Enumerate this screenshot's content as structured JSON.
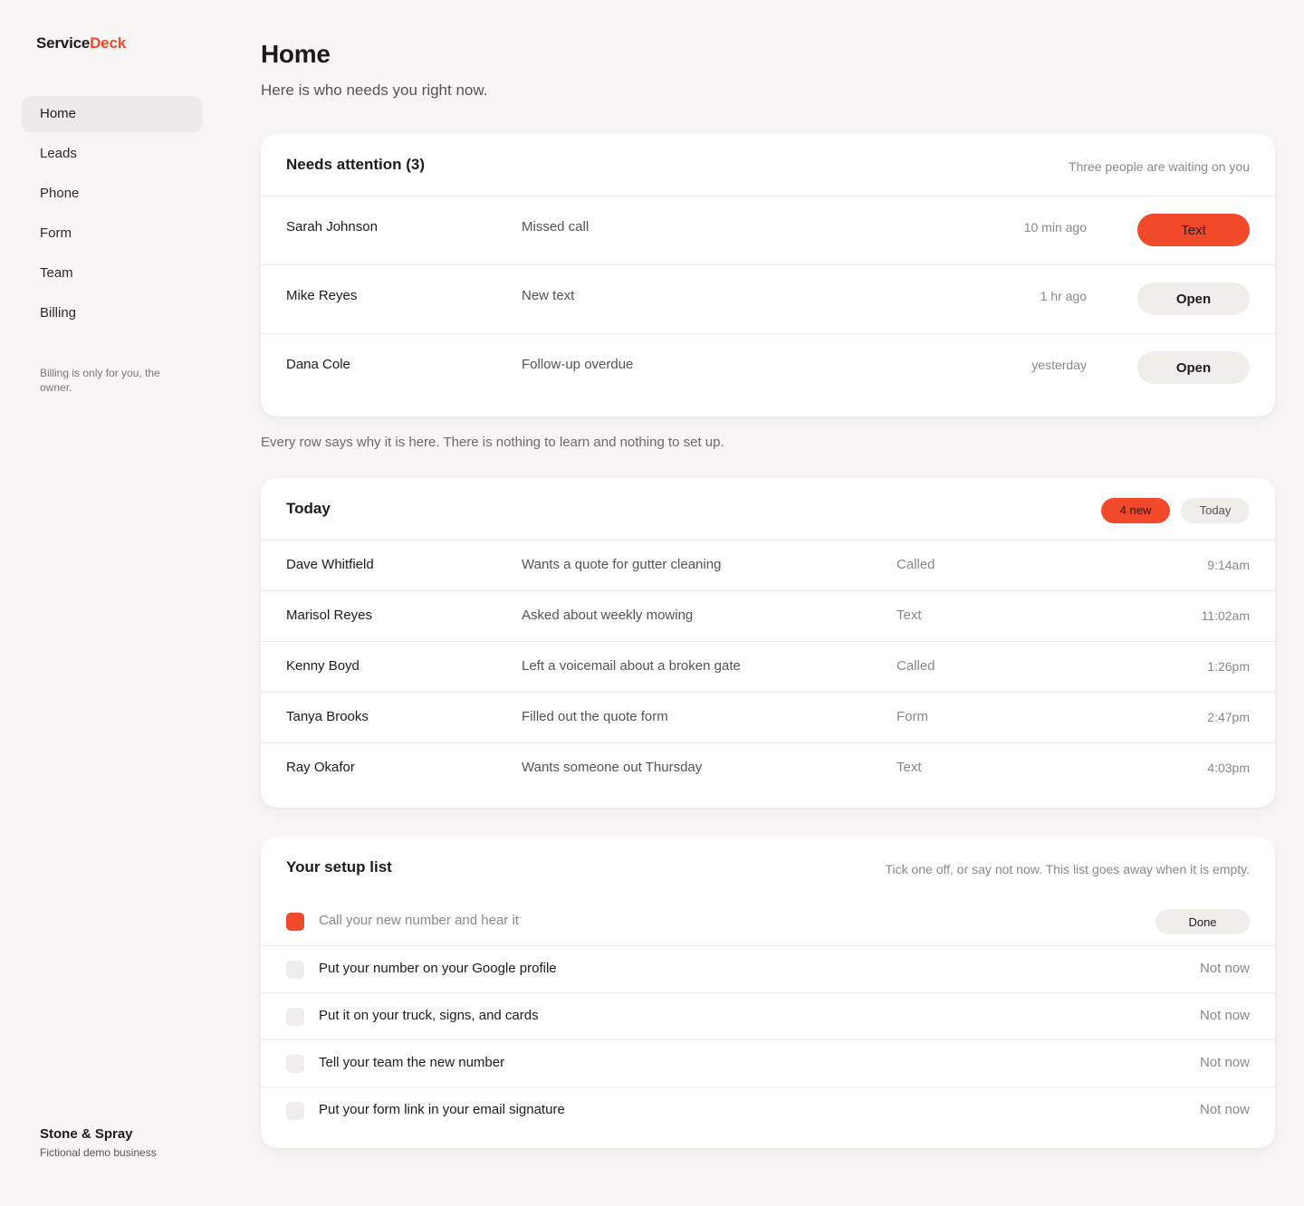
{
  "brand": {
    "part1": "Service",
    "part2": "Deck",
    "accent": "#f04a2a"
  },
  "nav": {
    "items": [
      {
        "label": "Home",
        "active": true
      },
      {
        "label": "Leads"
      },
      {
        "label": "Phone"
      },
      {
        "label": "Form"
      },
      {
        "label": "Team"
      },
      {
        "label": "Billing"
      }
    ],
    "billing_note": "Billing is only for you, the owner."
  },
  "business": {
    "name": "Stone & Spray",
    "subtitle": "Fictional demo business"
  },
  "page": {
    "title": "Home",
    "subtitle": "Here is who needs you right now."
  },
  "attention": {
    "title": "Needs attention (3)",
    "hint": "Three people are waiting on you",
    "rows": [
      {
        "name": "Sarah Johnson",
        "reason": "Missed call",
        "time": "10 min ago",
        "action": "Text"
      },
      {
        "name": "Mike Reyes",
        "reason": "New text",
        "time": "1 hr ago",
        "action": "Open"
      },
      {
        "name": "Dana Cole",
        "reason": "Follow-up overdue",
        "time": "yesterday",
        "action": "Open"
      }
    ]
  },
  "between_note": "Every row says why it is here. There is nothing to learn and nothing to set up.",
  "today": {
    "title": "Today",
    "new_badge": "4 new",
    "filter": "Today",
    "rows": [
      {
        "name": "Dave Whitfield",
        "desc": "Wants a quote for gutter cleaning",
        "channel": "Called",
        "time": "9:14am"
      },
      {
        "name": "Marisol Reyes",
        "desc": "Asked about weekly mowing",
        "channel": "Text",
        "time": "11:02am"
      },
      {
        "name": "Kenny Boyd",
        "desc": "Left a voicemail about a broken gate",
        "channel": "Called",
        "time": "1:26pm"
      },
      {
        "name": "Tanya Brooks",
        "desc": "Filled out the quote form",
        "channel": "Form",
        "time": "2:47pm"
      },
      {
        "name": "Ray Okafor",
        "desc": "Wants someone out Thursday",
        "channel": "Text",
        "time": "4:03pm"
      }
    ]
  },
  "setup": {
    "title": "Your setup list",
    "hint": "Tick one off, or say not now. This list goes away when it is empty.",
    "items": [
      {
        "label": "Call your new number and hear it",
        "checked": true,
        "action": "Done"
      },
      {
        "label": "Put your number on your Google profile",
        "checked": false,
        "action": "Not now"
      },
      {
        "label": "Put it on your truck, signs, and cards",
        "checked": false,
        "action": "Not now"
      },
      {
        "label": "Tell your team the new number",
        "checked": false,
        "action": "Not now"
      },
      {
        "label": "Put your form link in your email signature",
        "checked": false,
        "action": "Not now"
      }
    ]
  }
}
